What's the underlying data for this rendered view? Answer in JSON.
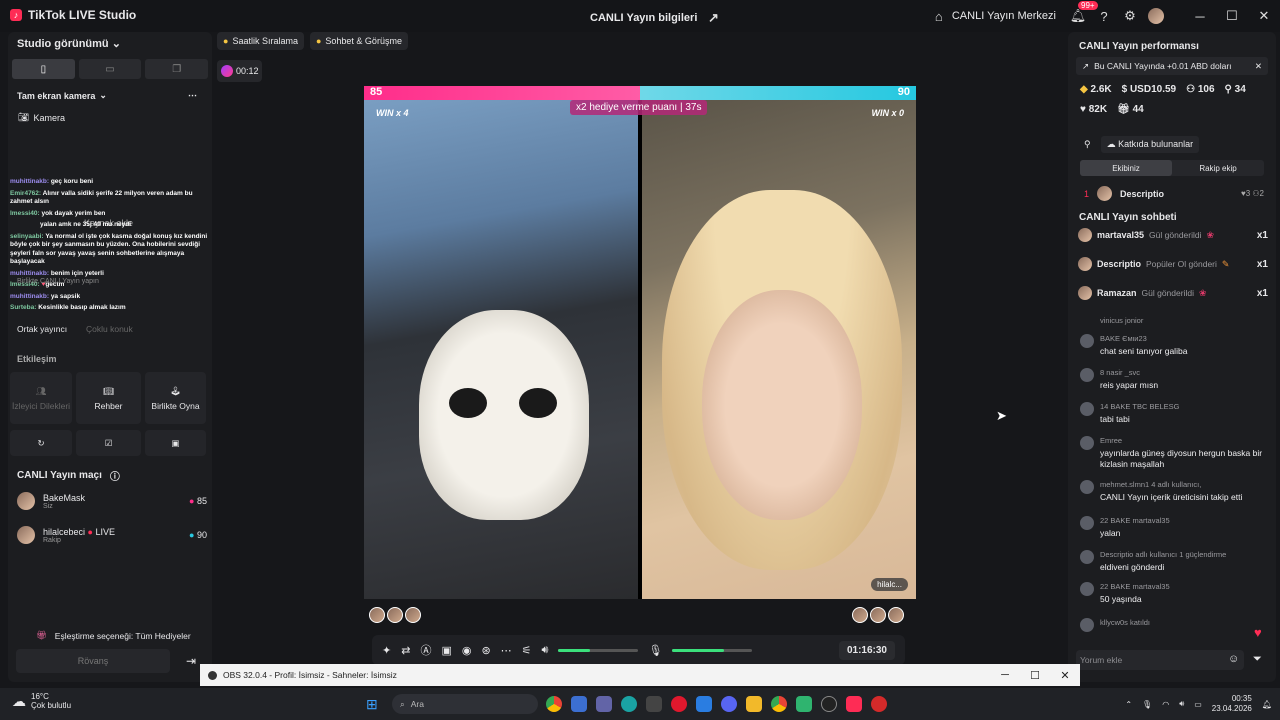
{
  "app": {
    "title": "TikTok LIVE Studio",
    "center_title": "CANLI Yayın bilgileri",
    "live_center": "CANLI Yayın Merkezi",
    "notif_count": "99+"
  },
  "left": {
    "studio_view": "Studio görünümü",
    "fullscreen_camera": "Tam ekran kamera",
    "camera": "Kamera",
    "add_source": "Kaynak ekle",
    "chat_overlay": [
      {
        "user": "muhittinakb:",
        "text": "geç koru beni"
      },
      {
        "user": "Emir4762:",
        "text": "Alınır valla sidiki şerife 22 milyon veren adam bu zahmet alsın"
      },
      {
        "user": "Imessi40:",
        "text": "yok dayak yerim ben"
      },
      {
        "user": "",
        "text": "yalan amk ne 35j 49 mu neydi"
      },
      {
        "user": "selinyaabi:",
        "text": "Ya normal ol işte çok kasma doğal konuş kız kendini böyle çok bir şey sanmasın bu yüzden. Ona hobilerini sevdiği şeyleri faln sor yavaş yavaş senin sohbetlerine alışmaya başlayacak"
      },
      {
        "user": "muhittinakb:",
        "text": "benim için yeterli"
      },
      {
        "user": "Imessi40:",
        "text": "gectm"
      },
      {
        "user": "muhittinakb:",
        "text": "ya sapsik"
      },
      {
        "user": "Surteba:",
        "text": "Kesinlikle basıp almak lazım"
      }
    ],
    "guest_label": "Ortak yayıncı",
    "multi_label": "Çoklu konuk",
    "collab_hint": "Birlikte CANLI Yayın yapın",
    "interaction": "Etkileşim",
    "tiles": [
      "İzleyici Dilekleri",
      "Rehber",
      "Birlikte Oyna"
    ],
    "match_title": "CANLI Yayın maçı",
    "players": [
      {
        "name": "BakeMask",
        "sub": "Siz",
        "score": "85"
      },
      {
        "name": "hilalcebeci",
        "live": "LIVE",
        "sub": "Rakip",
        "score": "90"
      }
    ],
    "pairing": "Eşleştirme seçeneği: Tüm Hediyeler",
    "rematch": "Rövanş"
  },
  "center": {
    "chip1": "Saatlik Sıralama",
    "chip2": "Sohbet & Görüşme",
    "elapsed": "00:12",
    "score_left": "85",
    "score_right": "90",
    "multiplier": "x2 hediye verme puanı",
    "countdown": "37s",
    "win_left": "WIN x 4",
    "win_right": "WIN x 0",
    "opponent_chip": "hilalc...",
    "timer": "01:16:30",
    "mic_level": 0.65,
    "volume_level": 0.4
  },
  "right": {
    "perf_title": "CANLI Yayın performansı",
    "banner": "Bu CANLI Yayında +0.01 ABD doları",
    "stats": [
      "2.6K",
      "USD10.59",
      "106",
      "34",
      "82K",
      "44"
    ],
    "contributors": "Katkıda bulunanlar",
    "tab_team": "Ekibiniz",
    "tab_rival": "Rakip ekip",
    "top_rank": "1",
    "top_user": "Descriptio",
    "top_hearts": "3",
    "top_people": "2",
    "chat_title": "CANLI Yayın sohbeti",
    "gifts": [
      {
        "user": "martaval35",
        "text": "Gül gönderildi",
        "count": "x1"
      },
      {
        "user": "Descriptio",
        "text": "Popüler Ol gönderi",
        "count": "x1"
      },
      {
        "user": "Ramazan",
        "text": "Gül gönderildi",
        "count": "x1"
      }
    ],
    "messages": [
      {
        "name": "vinicus jonior",
        "text": ""
      },
      {
        "name": "BAKE Ємιи23",
        "text": "chat seni tanıyor galiba"
      },
      {
        "name": "8 nasir _svc",
        "text": "reis yapar mısn"
      },
      {
        "name": "14 BAKE TBC BELESG",
        "text": "tabi tabi"
      },
      {
        "name": "Emree",
        "text": "yayınlarda güneş diyosun hergun baska bir kizlasin maşallah"
      },
      {
        "name": "mehmet.slmn1 4 adlı kullanıcı,",
        "text": "CANLI Yayın içerik üreticisini takip etti"
      },
      {
        "name": "22 BAKE martaval35",
        "text": "yalan"
      },
      {
        "name": "Descriptio adlı kullanıcı 1 güçlendirme",
        "text": "eldiveni gönderdi"
      },
      {
        "name": "22 BAKE martaval35",
        "text": "50 yaşında"
      },
      {
        "name": "kllycw0s katıldı",
        "text": ""
      }
    ],
    "comment_placeholder": "Yorum ekle"
  },
  "obs": {
    "title": "OBS 32.0.4 - Profil: İsimsiz - Sahneler: İsimsiz"
  },
  "taskbar": {
    "temp": "16°C",
    "weather": "Çok bulutlu",
    "search": "Ara",
    "time": "00:35",
    "date": "23.04.2026"
  }
}
